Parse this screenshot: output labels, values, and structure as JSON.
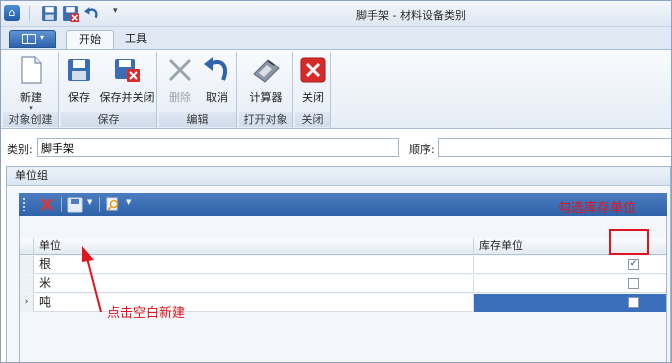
{
  "window": {
    "title": "脚手架 - 材料设备类别"
  },
  "qat": {
    "dropdown_glyph": "▾"
  },
  "tabs": [
    {
      "label": "开始"
    },
    {
      "label": "工具"
    }
  ],
  "ribbon": {
    "groups": [
      {
        "label": "对象创建",
        "buttons": [
          {
            "label": "新建",
            "icon": "new-doc-icon"
          }
        ]
      },
      {
        "label": "保存",
        "buttons": [
          {
            "label": "保存",
            "icon": "save-icon"
          },
          {
            "label": "保存并关闭",
            "icon": "save-close-icon"
          }
        ]
      },
      {
        "label": "编辑",
        "buttons": [
          {
            "label": "删除",
            "icon": "delete-x-icon"
          },
          {
            "label": "取消",
            "icon": "undo-icon"
          }
        ]
      },
      {
        "label": "打开对象",
        "buttons": [
          {
            "label": "计算器",
            "icon": "calculator-icon"
          }
        ]
      },
      {
        "label": "关闭",
        "buttons": [
          {
            "label": "关闭",
            "icon": "close-red-icon"
          }
        ]
      }
    ]
  },
  "form": {
    "category_label": "类别:",
    "category_value": "脚手架",
    "order_label": "顺序:",
    "order_value": ""
  },
  "panel": {
    "title": "单位组"
  },
  "grid": {
    "columns": [
      "单位",
      "库存单位"
    ],
    "rows": [
      {
        "unit": "根",
        "stock_unit": true,
        "indicator": ""
      },
      {
        "unit": "米",
        "stock_unit": false,
        "indicator": ""
      },
      {
        "unit": "吨",
        "stock_unit": false,
        "indicator": "›"
      }
    ],
    "check_glyph": "✓"
  },
  "annotations": {
    "stock_unit_hint": "勾选库存单位",
    "new_row_hint": "点击空白新建"
  },
  "colors": {
    "annotation": "#e0141e",
    "toolbar_blue": "#2f62a8",
    "selection": "#3a6fbb"
  }
}
